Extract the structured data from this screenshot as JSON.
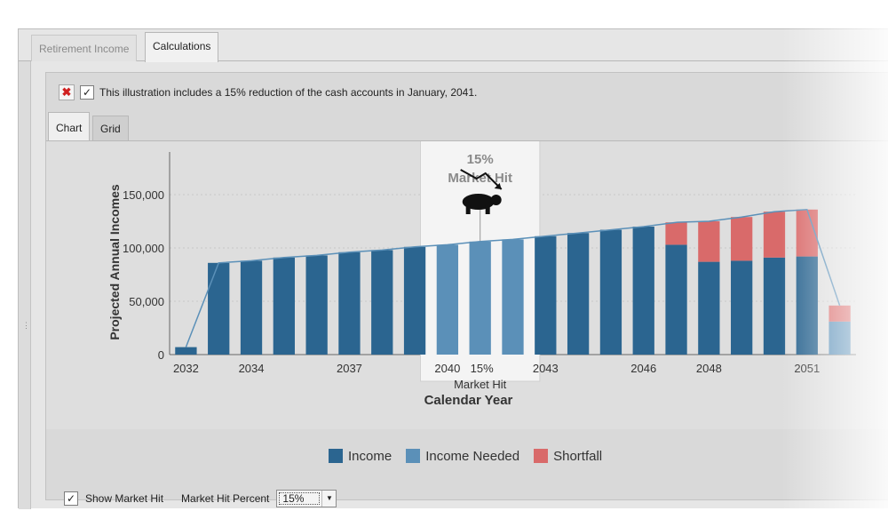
{
  "tabs": [
    {
      "label": "Retirement Income",
      "active": false
    },
    {
      "label": "Calculations",
      "active": true
    }
  ],
  "notice": {
    "checked": true,
    "text": "This illustration includes a 15% reduction of the cash accounts in January, 2041."
  },
  "subtabs": [
    {
      "label": "Chart",
      "active": true
    },
    {
      "label": "Grid",
      "active": false
    }
  ],
  "controls": {
    "show_market_hit_label": "Show Market Hit",
    "show_market_hit_checked": true,
    "market_hit_percent_label": "Market Hit Percent",
    "market_hit_percent_value": "15%"
  },
  "market_hit": {
    "percent_text": "15%",
    "title_text": "Market Hit",
    "axis_label_percent": "15%",
    "axis_label_text": "Market Hit",
    "icon": "bear-icon"
  },
  "colors": {
    "income": "#2b6590",
    "income_needed": "#5b90b8",
    "shortfall": "#d96a6a"
  },
  "chart_data": {
    "type": "bar",
    "stacked": true,
    "title": "",
    "xlabel": "Calendar Year",
    "ylabel": "Projected Annual Incomes",
    "ylim": [
      0,
      190000
    ],
    "y_ticks": [
      "0",
      "50,000",
      "100,000",
      "150,000"
    ],
    "y_tick_values": [
      0,
      50000,
      100000,
      150000
    ],
    "x_tick_labels": [
      {
        "index": 0,
        "label": "2032"
      },
      {
        "index": 2,
        "label": "2034"
      },
      {
        "index": 5,
        "label": "2037"
      },
      {
        "index": 8,
        "label": "2040"
      },
      {
        "index": 11,
        "label": "2043"
      },
      {
        "index": 14,
        "label": "2046"
      },
      {
        "index": 16,
        "label": "2048"
      },
      {
        "index": 19,
        "label": "2051"
      }
    ],
    "categories": [
      "2032",
      "2033",
      "2034",
      "2035",
      "2036",
      "2037",
      "2038",
      "2039",
      "2040",
      "2041",
      "2042",
      "2043",
      "2044",
      "2045",
      "2046",
      "2047",
      "2048",
      "2049",
      "2050",
      "2051",
      "2052"
    ],
    "series": [
      {
        "name": "Income",
        "values": [
          7000,
          86000,
          88000,
          91000,
          93000,
          96000,
          98000,
          101000,
          0,
          0,
          0,
          111000,
          114000,
          117000,
          120000,
          103000,
          87000,
          88000,
          91000,
          92000,
          0
        ]
      },
      {
        "name": "Income Needed",
        "values": [
          0,
          0,
          0,
          0,
          0,
          0,
          0,
          0,
          103000,
          106000,
          108000,
          0,
          0,
          0,
          0,
          0,
          0,
          0,
          0,
          0,
          31000
        ]
      },
      {
        "name": "Shortfall",
        "values": [
          0,
          0,
          0,
          0,
          0,
          0,
          0,
          0,
          0,
          0,
          0,
          0,
          0,
          0,
          0,
          21000,
          38000,
          41000,
          43000,
          44000,
          15000
        ]
      }
    ],
    "needed_line": [
      7000,
      86000,
      88000,
      91000,
      93000,
      96000,
      98000,
      101000,
      103000,
      106000,
      108000,
      111000,
      114000,
      117000,
      120000,
      124000,
      125000,
      129000,
      134000,
      136000,
      46000
    ],
    "legend": [
      "Income",
      "Income Needed",
      "Shortfall"
    ],
    "legend_position": "bottom",
    "grid": true,
    "highlight_index": 9
  }
}
